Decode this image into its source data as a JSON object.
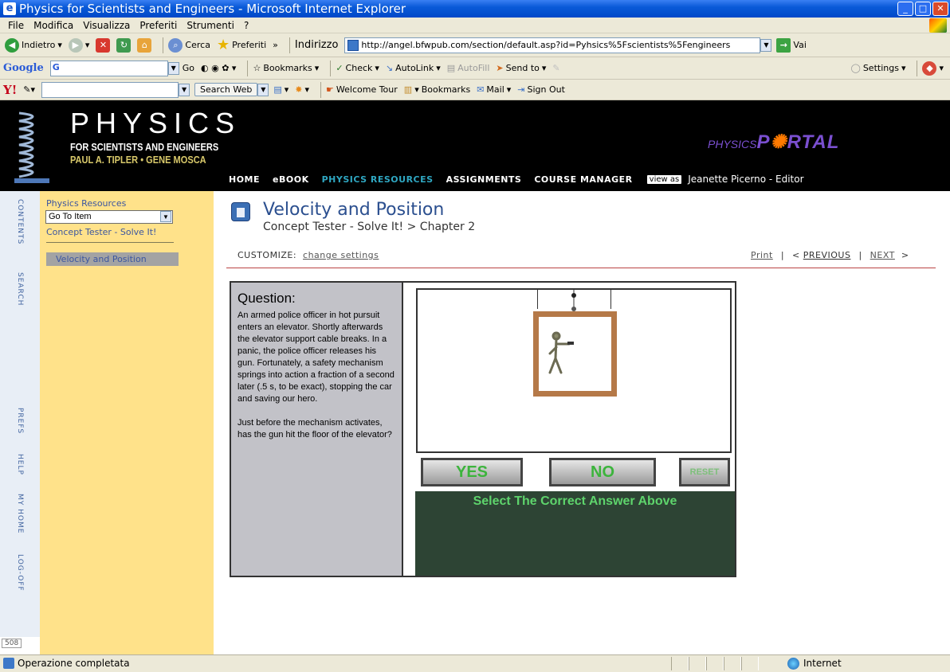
{
  "window": {
    "title": "Physics for Scientists and Engineers - Microsoft Internet Explorer"
  },
  "menu": [
    "File",
    "Modifica",
    "Visualizza",
    "Preferiti",
    "Strumenti",
    "?"
  ],
  "toolbar": {
    "back": "Indietro",
    "search": "Cerca",
    "favorites": "Preferiti",
    "chevron": "»",
    "address_label": "Indirizzo",
    "address_url": "http://angel.bfwpub.com/section/default.asp?id=Pyhsics%5Fscientists%5Fengineers",
    "go": "Vai"
  },
  "google_bar": {
    "logo": "Google",
    "g_field": "G",
    "go": "Go",
    "bookmarks": "Bookmarks",
    "check": "Check",
    "autolink": "AutoLink",
    "autofill": "AutoFill",
    "send_to": "Send to",
    "settings": "Settings"
  },
  "yahoo_bar": {
    "logo": "Y!",
    "search_web": "Search Web",
    "welcome_tour": "Welcome Tour",
    "bookmarks": "Bookmarks",
    "mail": "Mail",
    "sign_out": "Sign Out"
  },
  "site": {
    "brand_title": "PHYSICS",
    "brand_sub": "FOR SCIENTISTS AND ENGINEERS",
    "brand_authors": "PAUL A. TIPLER • GENE MOSCA",
    "portal_prefix": "PHYSICS",
    "portal_p": "P",
    "portal_rest": "RTAL",
    "nav": [
      "HOME",
      "eBOOK",
      "PHYSICS RESOURCES",
      "ASSIGNMENTS",
      "COURSE MANAGER"
    ],
    "view_as": "view as",
    "user": "Jeanette Picerno - Editor"
  },
  "sidebar": {
    "tabs": [
      "CONTENTS",
      "SEARCH",
      "PREFS",
      "HELP",
      "MY HOME",
      "LOG-OFF"
    ],
    "resources_link": "Physics Resources",
    "goto_select": "Go To Item",
    "concept_link": "Concept Tester - Solve It!",
    "current_item": "Velocity and Position",
    "page_number": "508"
  },
  "content": {
    "title": "Velocity and Position",
    "breadcrumb": "Concept Tester - Solve It! > Chapter 2",
    "customize_label": "CUSTOMIZE:",
    "customize_link": "change settings",
    "print": "Print",
    "divider": "|",
    "previous": "< PREVIOUS",
    "next": "NEXT",
    "next_arrow": ">"
  },
  "applet": {
    "question_heading": "Question:",
    "question_body": "An armed police officer in hot pursuit enters an elevator.  Shortly afterwards the elevator support cable breaks.  In a panic, the police officer releases his gun. Fortunately, a safety mechanism springs into action a fraction of a second later (.5 s, to be exact), stopping the car and saving our hero.",
    "question_prompt": "Just before the mechanism activates, has the gun hit the floor of the elevator?",
    "yes": "YES",
    "no": "NO",
    "reset": "RESET",
    "message": "Select The Correct Answer Above"
  },
  "status": {
    "text": "Operazione completata",
    "zone": "Internet"
  }
}
